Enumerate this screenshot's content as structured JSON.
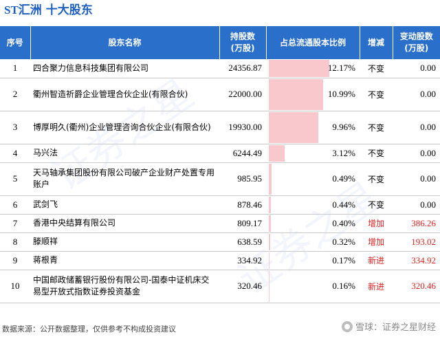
{
  "title_code": "ST汇洲",
  "title_text": "十大股东",
  "headers": {
    "idx": "序号",
    "name": "股东名称",
    "shares": "持股数\n(万股)",
    "ratio": "占总流通股本比例",
    "change": "增减",
    "delta": "变动股数\n(万股)"
  },
  "chart_data": {
    "type": "table",
    "rows": [
      {
        "idx": "1",
        "name": "四合聚力信息科技集团有限公司",
        "shares": "24356.87",
        "ratio": 12.17,
        "ratio_label": "12.17%",
        "change": "不变",
        "delta": "0.00",
        "kind": "same"
      },
      {
        "idx": "2",
        "name": "衢州智造祈爵企业管理合伙企业(有限合伙)",
        "shares": "22000.00",
        "ratio": 10.99,
        "ratio_label": "10.99%",
        "change": "不变",
        "delta": "0.00",
        "kind": "same"
      },
      {
        "idx": "3",
        "name": "博厚明久(衢州)企业管理咨询合伙企业(有限合伙)",
        "shares": "19930.00",
        "ratio": 9.96,
        "ratio_label": "9.96%",
        "change": "不变",
        "delta": "0.00",
        "kind": "same"
      },
      {
        "idx": "4",
        "name": "马兴法",
        "shares": "6244.49",
        "ratio": 3.12,
        "ratio_label": "3.12%",
        "change": "不变",
        "delta": "0.00",
        "kind": "same"
      },
      {
        "idx": "5",
        "name": "天马轴承集团股份有限公司破产企业财产处置专用账户",
        "shares": "985.95",
        "ratio": 0.49,
        "ratio_label": "0.49%",
        "change": "不变",
        "delta": "0.00",
        "kind": "same"
      },
      {
        "idx": "6",
        "name": "武剑飞",
        "shares": "878.46",
        "ratio": 0.44,
        "ratio_label": "0.44%",
        "change": "不变",
        "delta": "0.00",
        "kind": "same"
      },
      {
        "idx": "7",
        "name": "香港中央结算有限公司",
        "shares": "809.17",
        "ratio": 0.4,
        "ratio_label": "0.40%",
        "change": "增加",
        "delta": "386.26",
        "kind": "up"
      },
      {
        "idx": "8",
        "name": "滕顺祥",
        "shares": "638.59",
        "ratio": 0.32,
        "ratio_label": "0.32%",
        "change": "增加",
        "delta": "193.02",
        "kind": "up"
      },
      {
        "idx": "9",
        "name": "蒋根青",
        "shares": "334.92",
        "ratio": 0.17,
        "ratio_label": "0.17%",
        "change": "新进",
        "delta": "334.92",
        "kind": "new"
      },
      {
        "idx": "10",
        "name": "中国邮政储蓄银行股份有限公司-国泰中证机床交易型开放式指数证券投资基金",
        "shares": "320.46",
        "ratio": 0.16,
        "ratio_label": "0.16%",
        "change": "新进",
        "delta": "320.46",
        "kind": "new"
      }
    ],
    "ratio_max": 12.17
  },
  "footer": "数据来源：公开数据整理，仅供参考不构成投资建议",
  "brand": "雪球：证券之星财经",
  "watermark": "证券之星",
  "colors": {
    "header_bg": "#2a6fc9",
    "title": "#1f5fbf",
    "bar": "#f9c8cc",
    "up": "#e0201f"
  }
}
